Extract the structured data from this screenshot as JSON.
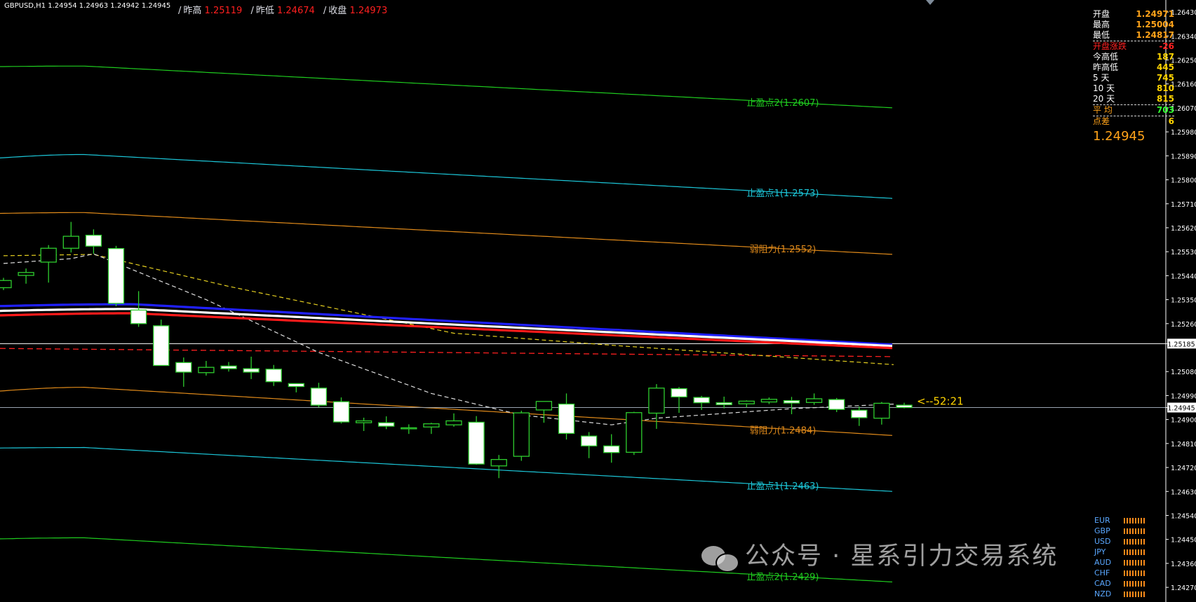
{
  "header": {
    "symbol_info": "GBPUSD,H1  1.24954 1.24963 1.24942 1.24945",
    "stats": [
      {
        "label": "昨高",
        "value": "1.25119"
      },
      {
        "label": "昨低",
        "value": "1.24674"
      },
      {
        "label": "收盘",
        "value": "1.24973"
      }
    ]
  },
  "info_panel": {
    "rows": [
      {
        "label": "开盘",
        "value": "1.24971",
        "label_color": "#ffffff",
        "value_color": "#ffa31a"
      },
      {
        "label": "最高",
        "value": "1.25004",
        "label_color": "#ffffff",
        "value_color": "#ffa31a"
      },
      {
        "label": "最低",
        "value": "1.24817",
        "label_color": "#ffffff",
        "value_color": "#ffa31a"
      },
      {
        "label": "开盘涨跌",
        "value": "-26",
        "label_color": "#ff2020",
        "value_color": "#ff2020"
      },
      {
        "label": "今高低",
        "value": "187",
        "label_color": "#ffffff",
        "value_color": "#ffd400"
      },
      {
        "label": "昨高低",
        "value": "445",
        "label_color": "#ffffff",
        "value_color": "#ffd400"
      },
      {
        "label": "5 天",
        "value": "745",
        "label_color": "#ffffff",
        "value_color": "#ffd400"
      },
      {
        "label": "10 天",
        "value": "810",
        "label_color": "#ffffff",
        "value_color": "#ffd400"
      },
      {
        "label": "20 天",
        "value": "815",
        "label_color": "#ffffff",
        "value_color": "#ffd400"
      },
      {
        "label": "平 均",
        "value": "703",
        "label_color": "#ffa31a",
        "value_color": "#30ff30"
      },
      {
        "label": "点差",
        "value": "6",
        "label_color": "#ffa31a",
        "value_color": "#ffd400"
      }
    ],
    "current_price": "1.24945"
  },
  "countdown": "<--52:21",
  "watermark": "公众号 · 星系引力交易系统",
  "currencies": [
    "EUR",
    "GBP",
    "USD",
    "JPY",
    "AUD",
    "CHF",
    "CAD",
    "NZD"
  ],
  "chart_data": {
    "type": "candlestick",
    "symbol": "GBPUSD",
    "timeframe": "H1",
    "ylim": [
      1.24215,
      1.26475
    ],
    "y_ticks": [
      "1.26430",
      "1.26340",
      "1.26250",
      "1.26160",
      "1.26070",
      "1.25980",
      "1.25890",
      "1.25800",
      "1.25710",
      "1.25620",
      "1.25530",
      "1.25440",
      "1.25350",
      "1.25260",
      "1.25185",
      "1.25080",
      "1.24990",
      "1.24945",
      "1.24900",
      "1.24810",
      "1.24720",
      "1.24630",
      "1.24540",
      "1.24450",
      "1.24360",
      "1.24270"
    ],
    "current_price": 1.24945,
    "candles": [
      [
        1.25395,
        1.25432,
        1.25386,
        1.25422
      ],
      [
        1.25441,
        1.25467,
        1.2541,
        1.25452
      ],
      [
        1.25491,
        1.25555,
        1.25414,
        1.25543
      ],
      [
        1.25543,
        1.25642,
        1.25527,
        1.25588
      ],
      [
        1.25592,
        1.25614,
        1.25522,
        1.25551
      ],
      [
        1.25542,
        1.25552,
        1.25325,
        1.25336
      ],
      [
        1.25311,
        1.25382,
        1.25248,
        1.2526
      ],
      [
        1.25252,
        1.25275,
        1.25102,
        1.25103
      ],
      [
        1.25114,
        1.25133,
        1.25023,
        1.25078
      ],
      [
        1.25076,
        1.2512,
        1.25065,
        1.25096
      ],
      [
        1.25101,
        1.25116,
        1.2508,
        1.25091
      ],
      [
        1.25091,
        1.25136,
        1.25052,
        1.25078
      ],
      [
        1.25089,
        1.25105,
        1.25026,
        1.25042
      ],
      [
        1.25035,
        1.25036,
        1.25002,
        1.25024
      ],
      [
        1.25018,
        1.25038,
        1.24946,
        1.24954
      ],
      [
        1.24967,
        1.24983,
        1.24885,
        1.24891
      ],
      [
        1.24888,
        1.24907,
        1.24857,
        1.24895
      ],
      [
        1.24888,
        1.24912,
        1.24864,
        1.24875
      ],
      [
        1.24868,
        1.24882,
        1.24846,
        1.24869
      ],
      [
        1.24872,
        1.24888,
        1.24846,
        1.24884
      ],
      [
        1.2488,
        1.24923,
        1.24873,
        1.24895
      ],
      [
        1.2489,
        1.24913,
        1.2473,
        1.24733
      ],
      [
        1.24726,
        1.24767,
        1.2468,
        1.2475
      ],
      [
        1.24762,
        1.24933,
        1.24745,
        1.24925
      ],
      [
        1.24936,
        1.24962,
        1.24888,
        1.24968
      ],
      [
        1.24958,
        1.24998,
        1.24825,
        1.24848
      ],
      [
        1.24838,
        1.24853,
        1.24755,
        1.24801
      ],
      [
        1.24801,
        1.24845,
        1.24738,
        1.24776
      ],
      [
        1.24777,
        1.24929,
        1.24767,
        1.24926
      ],
      [
        1.24924,
        1.25033,
        1.24865,
        1.25018
      ],
      [
        1.25016,
        1.25022,
        1.24925,
        1.24985
      ],
      [
        1.24983,
        1.24989,
        1.24936,
        1.24963
      ],
      [
        1.24963,
        1.24986,
        1.24942,
        1.24956
      ],
      [
        1.24959,
        1.24972,
        1.24945,
        1.24969
      ],
      [
        1.24966,
        1.24983,
        1.24958,
        1.24976
      ],
      [
        1.24971,
        1.24985,
        1.2492,
        1.24962
      ],
      [
        1.24964,
        1.24998,
        1.24955,
        1.24978
      ],
      [
        1.24975,
        1.24981,
        1.24928,
        1.24938
      ],
      [
        1.24935,
        1.24949,
        1.24876,
        1.24907
      ],
      [
        1.24905,
        1.24966,
        1.24881,
        1.24961
      ],
      [
        1.24954,
        1.24963,
        1.24942,
        1.24945
      ]
    ],
    "levels": [
      {
        "label": "止盈点2(1.2607)",
        "value": 1.2607,
        "start": 1.26225,
        "peak": 1.26227,
        "color": "#1fcc1f"
      },
      {
        "label": "止盈点1(1.2573)",
        "value": 1.2573,
        "start": 1.25882,
        "peak": 1.25895,
        "color": "#1cc6d8"
      },
      {
        "label": "弱阻力(1.2552)",
        "value": 1.2552,
        "start": 1.25674,
        "peak": 1.25677,
        "color": "#e08a1a"
      },
      {
        "label": "弱阻力(1.2484)",
        "value": 1.2484,
        "start": 1.25007,
        "peak": 1.25021,
        "color": "#e08a1a"
      },
      {
        "label": "止盈点1(1.2463)",
        "value": 1.2463,
        "start": 1.24793,
        "peak": 1.24795,
        "color": "#1cc6d8"
      },
      {
        "label": "止盈点2(1.2429)",
        "value": 1.2429,
        "start": 1.24452,
        "peak": 1.24456,
        "color": "#1fcc1f"
      }
    ],
    "moving_averages": [
      {
        "color": "#2020ff",
        "start": 1.25326,
        "peak": 1.25333,
        "end": 1.25181
      },
      {
        "color": "#ffffff",
        "start": 1.25308,
        "peak": 1.25315,
        "end": 1.25176
      },
      {
        "color": "#ff1a1a",
        "start": 1.25291,
        "peak": 1.25299,
        "end": 1.25168
      }
    ],
    "red_dashed": {
      "start": 1.25167,
      "end": 1.25136
    },
    "yellow_dashed": [
      [
        0,
        1.25515
      ],
      [
        4,
        1.2552
      ],
      [
        10,
        1.254
      ],
      [
        20,
        1.25224
      ],
      [
        27,
        1.25179
      ],
      [
        40,
        1.25106
      ]
    ],
    "white_dashed": [
      [
        0,
        1.25486
      ],
      [
        3,
        1.25504
      ],
      [
        4,
        1.25522
      ],
      [
        9,
        1.2535
      ],
      [
        14,
        1.25152
      ],
      [
        19,
        1.24998
      ],
      [
        23,
        1.24917
      ],
      [
        27,
        1.2488
      ],
      [
        29,
        1.24905
      ],
      [
        35,
        1.24941
      ],
      [
        40,
        1.24958
      ]
    ]
  }
}
